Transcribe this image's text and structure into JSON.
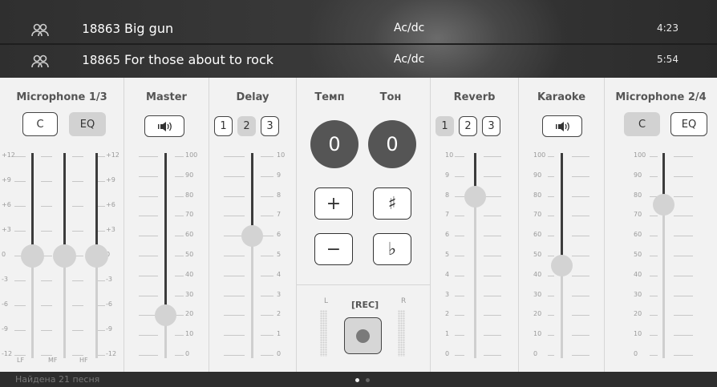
{
  "songs": [
    {
      "number": "18863",
      "title": "Big gun",
      "artist": "Ac/dc",
      "duration": "4:23",
      "icon": "people-icon"
    },
    {
      "number": "18865",
      "title": "For those about to rock",
      "artist": "Ac/dc",
      "duration": "5:54",
      "icon": "people-icon"
    }
  ],
  "mic1": {
    "title": "Microphone 1/3",
    "btn_c": "C",
    "btn_eq": "EQ",
    "scale": [
      "+12",
      "+9",
      "+6",
      "+3",
      "0",
      "-3",
      "-6",
      "-9",
      "-12"
    ],
    "bands": [
      "LF",
      "MF",
      "HF"
    ],
    "values": [
      0,
      0,
      0
    ]
  },
  "master": {
    "title": "Master",
    "scale": [
      "100",
      "90",
      "80",
      "70",
      "60",
      "50",
      "40",
      "30",
      "20",
      "10",
      "0"
    ],
    "value": 20
  },
  "delay": {
    "title": "Delay",
    "buttons": [
      "1",
      "2",
      "3"
    ],
    "active": "2",
    "scale": [
      "10",
      "9",
      "8",
      "7",
      "6",
      "5",
      "4",
      "3",
      "2",
      "1",
      "0"
    ],
    "value": 6
  },
  "tempo": {
    "label": "Темп",
    "value": "0",
    "plus": "+",
    "minus": "−"
  },
  "tone": {
    "label": "Тон",
    "value": "0",
    "sharp": "♯",
    "flat": "♭"
  },
  "rec": {
    "label": "[REC]",
    "left": "L",
    "right": "R"
  },
  "reverb": {
    "title": "Reverb",
    "buttons": [
      "1",
      "2",
      "3"
    ],
    "active": "1",
    "scale": [
      "10",
      "9",
      "8",
      "7",
      "6",
      "5",
      "4",
      "3",
      "2",
      "1",
      "0"
    ],
    "value": 8
  },
  "karaoke": {
    "title": "Karaoke",
    "scale": [
      "100",
      "90",
      "80",
      "70",
      "60",
      "50",
      "40",
      "30",
      "20",
      "10",
      "0"
    ],
    "value": 45
  },
  "mic2": {
    "title": "Microphone 2/4",
    "btn_c": "C",
    "btn_eq": "EQ",
    "scale": [
      "100",
      "90",
      "80",
      "70",
      "60",
      "50",
      "40",
      "30",
      "20",
      "10",
      "0"
    ],
    "value": 76
  },
  "status": {
    "text": "Найдена 21 песня",
    "pages": 2,
    "current": 1
  }
}
